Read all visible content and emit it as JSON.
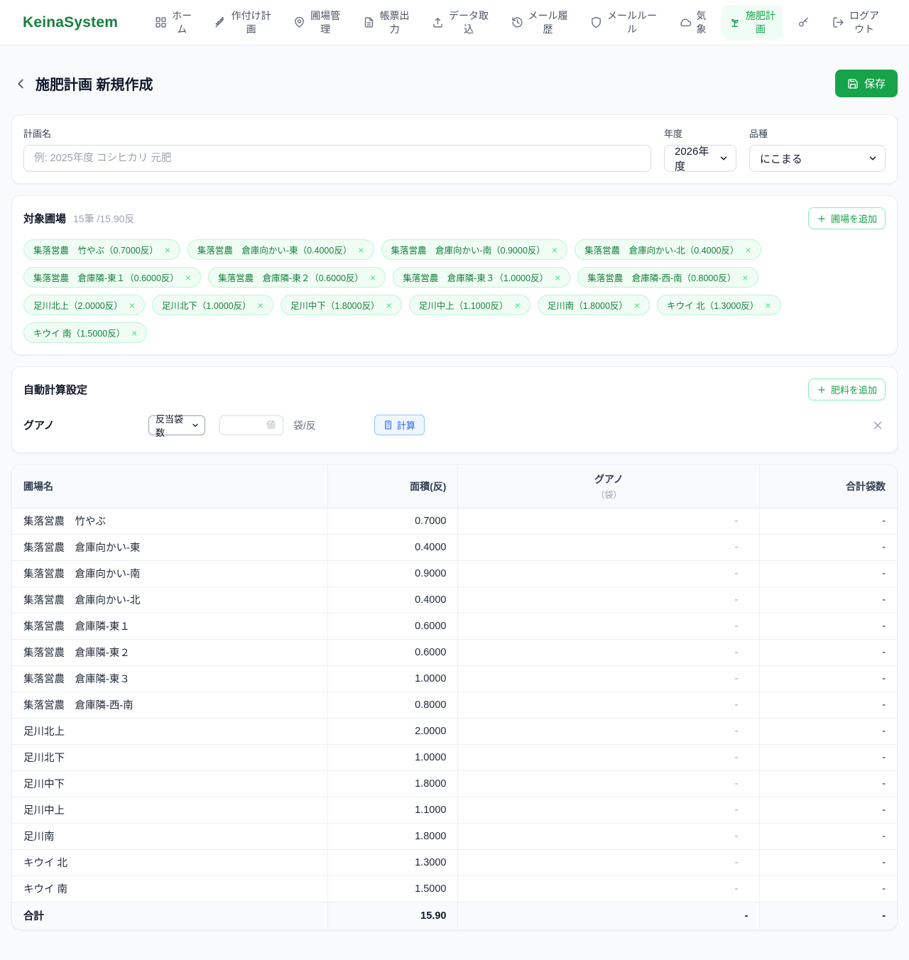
{
  "brand": "KeinaSystem",
  "colors": {
    "brand_green": "#15803d",
    "accent_green": "#16a34a",
    "active_nav_bg": "#f0fdf4",
    "chip_bg": "#f0fdf4",
    "chip_border": "#bbf7d0",
    "calc_blue": "#2563eb",
    "calc_blue_bg": "#eff6ff"
  },
  "nav": {
    "items": [
      {
        "id": "home",
        "icon": "grid",
        "label": "ホー\nム",
        "active": false
      },
      {
        "id": "planting-plan",
        "icon": "wheat",
        "label": "作付け計\n画",
        "active": false
      },
      {
        "id": "field-management",
        "icon": "map-pin",
        "label": "圃場管\n理",
        "active": false
      },
      {
        "id": "report-output",
        "icon": "file-text",
        "label": "帳票出\n力",
        "active": false
      },
      {
        "id": "data-import",
        "icon": "upload",
        "label": "データ取\n込",
        "active": false
      },
      {
        "id": "mail-history",
        "icon": "history",
        "label": "メール履\n歴",
        "active": false
      },
      {
        "id": "mail-rules",
        "icon": "shield",
        "label": "メールルー\nル",
        "active": false
      },
      {
        "id": "weather",
        "icon": "cloud",
        "label": "気\n象",
        "active": false
      },
      {
        "id": "fertilization-plan",
        "icon": "sprout",
        "label": "施肥計\n画",
        "active": true
      },
      {
        "id": "key",
        "icon": "key",
        "label": "",
        "active": false
      },
      {
        "id": "logout",
        "icon": "log-out",
        "label": "ログア\nウト",
        "active": false
      }
    ]
  },
  "page": {
    "title": "施肥計画 新規作成",
    "save_label": "保存"
  },
  "plan_form": {
    "name_label": "計画名",
    "name_placeholder": "例: 2025年度 コシヒカリ 元肥",
    "year_label": "年度",
    "year_value": "2026年度",
    "variety_label": "品種",
    "variety_value": "にこまる"
  },
  "target_fields": {
    "title": "対象圃場",
    "summary": "15筆 /15.90反",
    "add_button": "圃場を追加",
    "chips": [
      "集落営農　竹やぶ（0.7000反）",
      "集落営農　倉庫向かい-東（0.4000反）",
      "集落営農　倉庫向かい-南（0.9000反）",
      "集落営農　倉庫向かい-北（0.4000反）",
      "集落営農　倉庫隣-東１（0.6000反）",
      "集落営農　倉庫隣-東２（0.6000反）",
      "集落営農　倉庫隣-東３（1.0000反）",
      "集落営農　倉庫隣-西-南（0.8000反）",
      "足川北上（2.0000反）",
      "足川北下（1.0000反）",
      "足川中下（1.8000反）",
      "足川中上（1.1000反）",
      "足川南（1.8000反）",
      "キウイ 北（1.3000反）",
      "キウイ 南（1.5000反）"
    ]
  },
  "auto_calc": {
    "title": "自動計算設定",
    "add_button": "肥料を追加",
    "row": {
      "fertilizer": "グアノ",
      "mode": "反当袋数",
      "value_placeholder": "値",
      "unit": "袋/反",
      "calc_label": "計算"
    }
  },
  "table": {
    "headers": {
      "field": "圃場名",
      "area": "面積(反)",
      "fertilizer": "グアノ",
      "fertilizer_unit": "（袋）",
      "total": "合計袋数"
    },
    "rows": [
      {
        "name": "集落営農　竹やぶ",
        "area": "0.7000",
        "fertilizer": "-",
        "total": "-"
      },
      {
        "name": "集落営農　倉庫向かい-東",
        "area": "0.4000",
        "fertilizer": "-",
        "total": "-"
      },
      {
        "name": "集落営農　倉庫向かい-南",
        "area": "0.9000",
        "fertilizer": "-",
        "total": "-"
      },
      {
        "name": "集落営農　倉庫向かい-北",
        "area": "0.4000",
        "fertilizer": "-",
        "total": "-"
      },
      {
        "name": "集落営農　倉庫隣-東１",
        "area": "0.6000",
        "fertilizer": "-",
        "total": "-"
      },
      {
        "name": "集落営農　倉庫隣-東２",
        "area": "0.6000",
        "fertilizer": "-",
        "total": "-"
      },
      {
        "name": "集落営農　倉庫隣-東３",
        "area": "1.0000",
        "fertilizer": "-",
        "total": "-"
      },
      {
        "name": "集落営農　倉庫隣-西-南",
        "area": "0.8000",
        "fertilizer": "-",
        "total": "-"
      },
      {
        "name": "足川北上",
        "area": "2.0000",
        "fertilizer": "-",
        "total": "-"
      },
      {
        "name": "足川北下",
        "area": "1.0000",
        "fertilizer": "-",
        "total": "-"
      },
      {
        "name": "足川中下",
        "area": "1.8000",
        "fertilizer": "-",
        "total": "-"
      },
      {
        "name": "足川中上",
        "area": "1.1000",
        "fertilizer": "-",
        "total": "-"
      },
      {
        "name": "足川南",
        "area": "1.8000",
        "fertilizer": "-",
        "total": "-"
      },
      {
        "name": "キウイ 北",
        "area": "1.3000",
        "fertilizer": "-",
        "total": "-"
      },
      {
        "name": "キウイ 南",
        "area": "1.5000",
        "fertilizer": "-",
        "total": "-"
      }
    ],
    "footer": {
      "name": "合計",
      "area": "15.90",
      "fertilizer": "-",
      "total": "-"
    }
  }
}
